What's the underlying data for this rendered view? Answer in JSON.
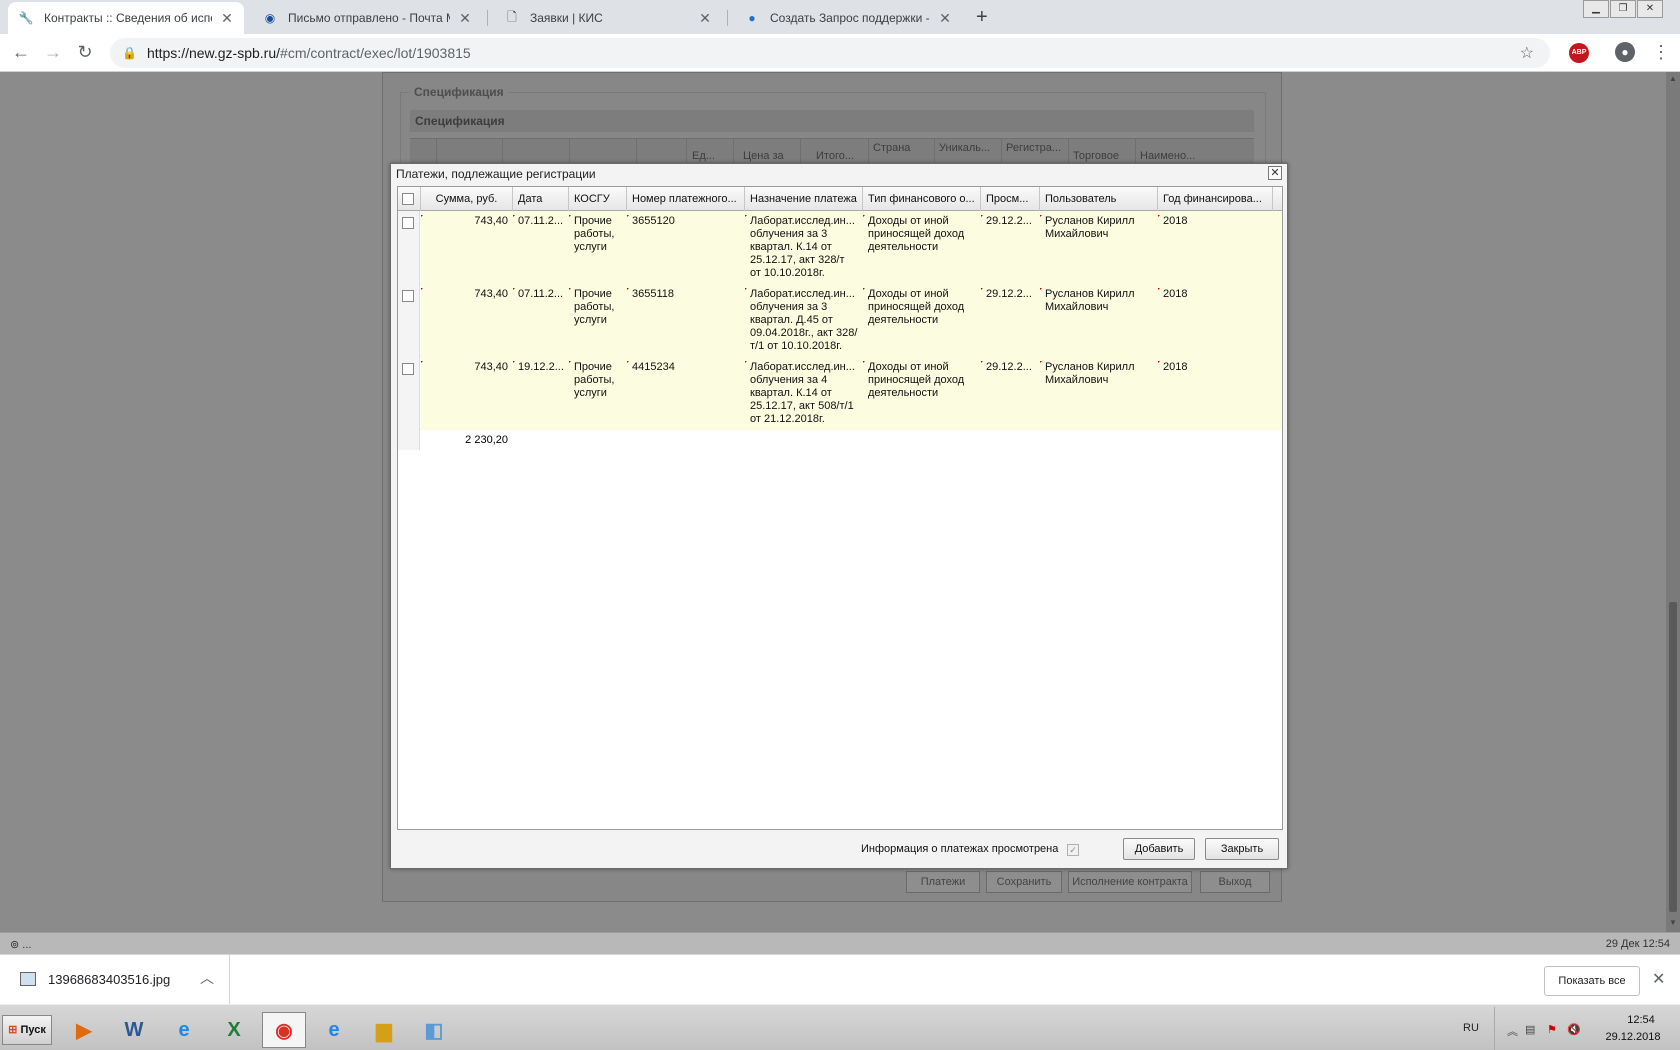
{
  "browser": {
    "tabs": [
      {
        "title": "Контракты :: Сведения об исполн",
        "icon": "tools-icon",
        "active": true
      },
      {
        "title": "Письмо отправлено - Почта Mail.Ru",
        "icon": "mail-ru-icon",
        "active": false
      },
      {
        "title": "Заявки | КИС",
        "icon": "document-icon",
        "active": false
      },
      {
        "title": "Создать Запрос поддержки - АИС",
        "icon": "globe-icon",
        "active": false
      }
    ],
    "url_host": "https://new.gz-spb.ru/",
    "url_path": "#cm/contract/exec/lot/1903815",
    "abp_label": "ABP"
  },
  "background_page": {
    "fieldset_legend": "Спецификация",
    "spec_bar_title": "Спецификация",
    "columns": [
      "Ед...",
      "Цена за",
      "Итого...",
      "Страна",
      "Уникаль...",
      "Регистра...",
      "Торговое",
      "Наимено..."
    ],
    "buttons": [
      "Платежи",
      "Сохранить",
      "Исполнение контракта",
      "Выход"
    ]
  },
  "dialog": {
    "title": "Платежи, подлежащие регистрации",
    "columns": [
      "Сумма, руб.",
      "Дата",
      "КОСГУ",
      "Номер платежного...",
      "Назначение платежа",
      "Тип финансового о...",
      "Просм...",
      "Пользователь",
      "Год финансирова..."
    ],
    "rows": [
      {
        "amount": "743,40",
        "date": "07.11.2...",
        "kosgu": "Прочие работы, услуги",
        "number": "3655120",
        "purpose": "Лаборат.исслед.ин... облучения за 3 квартал. К.14 от 25.12.17, акт 328/т от 10.10.2018г.",
        "fin_type": "Доходы от иной приносящей доход деятельности",
        "viewed": "29.12.2...",
        "user": "Русланов Кирилл Михайлович",
        "year": "2018"
      },
      {
        "amount": "743,40",
        "date": "07.11.2...",
        "kosgu": "Прочие работы, услуги",
        "number": "3655118",
        "purpose": "Лаборат.исслед.ин... облучения за 3 квартал. Д.45 от 09.04.2018г., акт 328/т/1 от 10.10.2018г.",
        "fin_type": "Доходы от иной приносящей доход деятельности",
        "viewed": "29.12.2...",
        "user": "Русланов Кирилл Михайлович",
        "year": "2018"
      },
      {
        "amount": "743,40",
        "date": "19.12.2...",
        "kosgu": "Прочие работы, услуги",
        "number": "4415234",
        "purpose": "Лаборат.исслед.ин... облучения за 4 квартал. К.14 от 25.12.17, акт 508/т/1 от 21.12.2018г.",
        "fin_type": "Доходы от иной приносящей доход деятельности",
        "viewed": "29.12.2...",
        "user": "Русланов Кирилл Михайлович",
        "year": "2018"
      }
    ],
    "total": "2 230,20",
    "viewed_label": "Информация о платежах просмотрена",
    "add_button": "Добавить",
    "close_button": "Закрыть"
  },
  "statusbar": {
    "left": "⊚ ...",
    "right": "29 Дек 12:54"
  },
  "downloads": {
    "file_name": "13968683403516.jpg",
    "show_all": "Показать все"
  },
  "taskbar": {
    "start_label": "Пуск",
    "apps": [
      "media-player-icon",
      "word-icon",
      "ie-icon",
      "excel-icon",
      "chrome-icon",
      "ie-icon",
      "explorer-folder-icon",
      "notepad-icon"
    ],
    "lang": "RU",
    "time": "12:54",
    "date": "29.12.2018"
  }
}
